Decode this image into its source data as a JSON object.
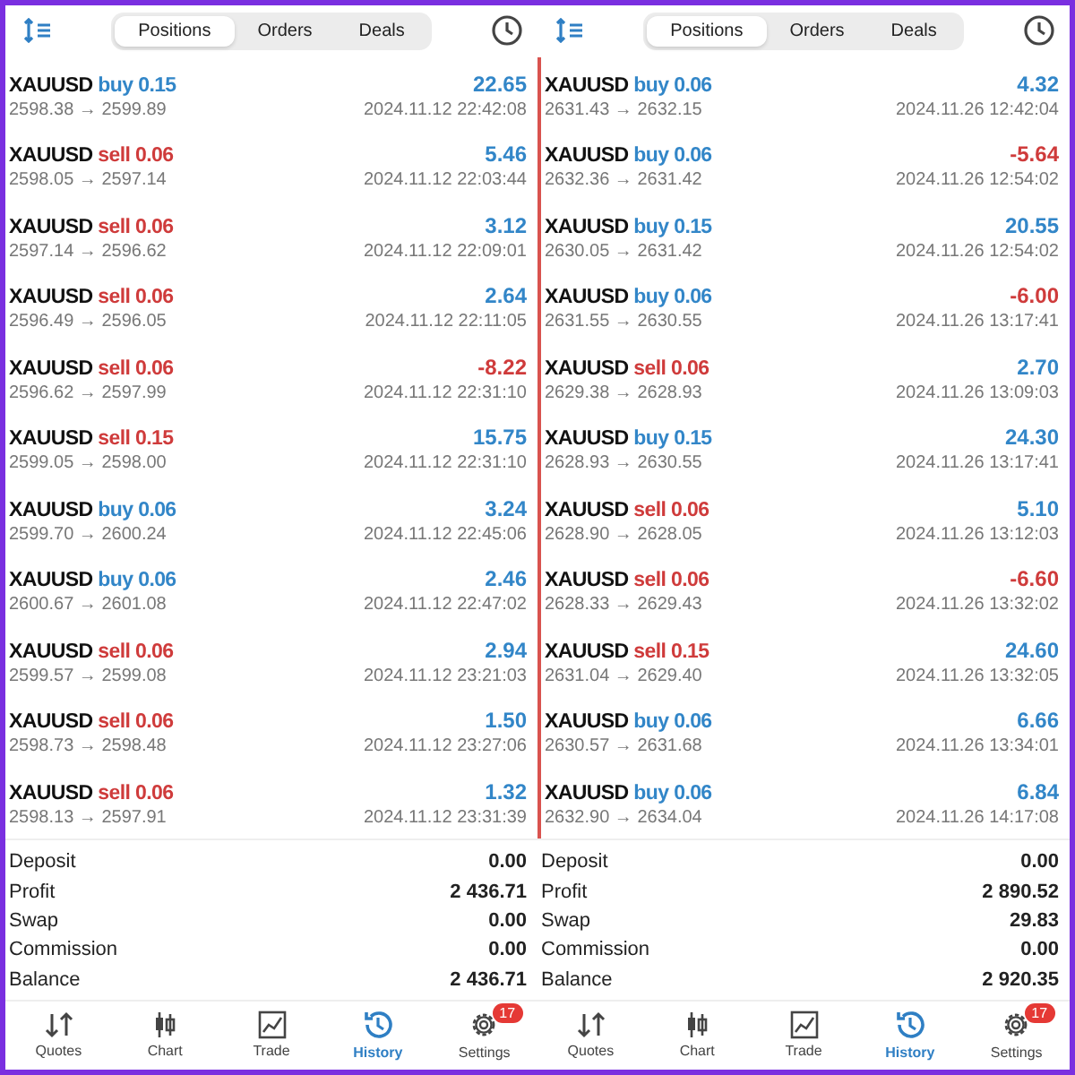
{
  "panels": [
    {
      "tabs": [
        {
          "label": "Positions",
          "selected": true
        },
        {
          "label": "Orders",
          "selected": false
        },
        {
          "label": "Deals",
          "selected": false
        }
      ],
      "trades": [
        {
          "symbol": "XAUUSD",
          "side": "buy",
          "volume": "0.15",
          "prices": "2598.38 → 2599.89",
          "profit": "22.65",
          "loss": false,
          "time": "2024.11.12 22:42:08"
        },
        {
          "symbol": "XAUUSD",
          "side": "sell",
          "volume": "0.06",
          "prices": "2598.05 → 2597.14",
          "profit": "5.46",
          "loss": false,
          "time": "2024.11.12 22:03:44"
        },
        {
          "symbol": "XAUUSD",
          "side": "sell",
          "volume": "0.06",
          "prices": "2597.14 → 2596.62",
          "profit": "3.12",
          "loss": false,
          "time": "2024.11.12 22:09:01"
        },
        {
          "symbol": "XAUUSD",
          "side": "sell",
          "volume": "0.06",
          "prices": "2596.49 → 2596.05",
          "profit": "2.64",
          "loss": false,
          "time": "2024.11.12 22:11:05"
        },
        {
          "symbol": "XAUUSD",
          "side": "sell",
          "volume": "0.06",
          "prices": "2596.62 → 2597.99",
          "profit": "-8.22",
          "loss": true,
          "time": "2024.11.12 22:31:10"
        },
        {
          "symbol": "XAUUSD",
          "side": "sell",
          "volume": "0.15",
          "prices": "2599.05 → 2598.00",
          "profit": "15.75",
          "loss": false,
          "time": "2024.11.12 22:31:10"
        },
        {
          "symbol": "XAUUSD",
          "side": "buy",
          "volume": "0.06",
          "prices": "2599.70 → 2600.24",
          "profit": "3.24",
          "loss": false,
          "time": "2024.11.12 22:45:06"
        },
        {
          "symbol": "XAUUSD",
          "side": "buy",
          "volume": "0.06",
          "prices": "2600.67 → 2601.08",
          "profit": "2.46",
          "loss": false,
          "time": "2024.11.12 22:47:02"
        },
        {
          "symbol": "XAUUSD",
          "side": "sell",
          "volume": "0.06",
          "prices": "2599.57 → 2599.08",
          "profit": "2.94",
          "loss": false,
          "time": "2024.11.12 23:21:03"
        },
        {
          "symbol": "XAUUSD",
          "side": "sell",
          "volume": "0.06",
          "prices": "2598.73 → 2598.48",
          "profit": "1.50",
          "loss": false,
          "time": "2024.11.12 23:27:06"
        },
        {
          "symbol": "XAUUSD",
          "side": "sell",
          "volume": "0.06",
          "prices": "2598.13 → 2597.91",
          "profit": "1.32",
          "loss": false,
          "time": "2024.11.12 23:31:39"
        }
      ],
      "summary": [
        {
          "label": "Deposit",
          "value": "0.00"
        },
        {
          "label": "Profit",
          "value": "2 436.71"
        },
        {
          "label": "Swap",
          "value": "0.00"
        },
        {
          "label": "Commission",
          "value": "0.00"
        },
        {
          "label": "Balance",
          "value": "2 436.71"
        }
      ],
      "nav": [
        {
          "kind": "quotes",
          "label": "Quotes",
          "selected": false
        },
        {
          "kind": "chart",
          "label": "Chart",
          "selected": false
        },
        {
          "kind": "trade",
          "label": "Trade",
          "selected": false
        },
        {
          "kind": "history",
          "label": "History",
          "selected": true
        },
        {
          "kind": "settings",
          "label": "Settings",
          "selected": false,
          "badge": "17"
        }
      ]
    },
    {
      "tabs": [
        {
          "label": "Positions",
          "selected": true
        },
        {
          "label": "Orders",
          "selected": false
        },
        {
          "label": "Deals",
          "selected": false
        }
      ],
      "trades": [
        {
          "symbol": "XAUUSD",
          "side": "buy",
          "volume": "0.06",
          "prices": "2631.43 → 2632.15",
          "profit": "4.32",
          "loss": false,
          "time": "2024.11.26 12:42:04"
        },
        {
          "symbol": "XAUUSD",
          "side": "buy",
          "volume": "0.06",
          "prices": "2632.36 → 2631.42",
          "profit": "-5.64",
          "loss": true,
          "time": "2024.11.26 12:54:02"
        },
        {
          "symbol": "XAUUSD",
          "side": "buy",
          "volume": "0.15",
          "prices": "2630.05 → 2631.42",
          "profit": "20.55",
          "loss": false,
          "time": "2024.11.26 12:54:02"
        },
        {
          "symbol": "XAUUSD",
          "side": "buy",
          "volume": "0.06",
          "prices": "2631.55 → 2630.55",
          "profit": "-6.00",
          "loss": true,
          "time": "2024.11.26 13:17:41"
        },
        {
          "symbol": "XAUUSD",
          "side": "sell",
          "volume": "0.06",
          "prices": "2629.38 → 2628.93",
          "profit": "2.70",
          "loss": false,
          "time": "2024.11.26 13:09:03"
        },
        {
          "symbol": "XAUUSD",
          "side": "buy",
          "volume": "0.15",
          "prices": "2628.93 → 2630.55",
          "profit": "24.30",
          "loss": false,
          "time": "2024.11.26 13:17:41"
        },
        {
          "symbol": "XAUUSD",
          "side": "sell",
          "volume": "0.06",
          "prices": "2628.90 → 2628.05",
          "profit": "5.10",
          "loss": false,
          "time": "2024.11.26 13:12:03"
        },
        {
          "symbol": "XAUUSD",
          "side": "sell",
          "volume": "0.06",
          "prices": "2628.33 → 2629.43",
          "profit": "-6.60",
          "loss": true,
          "time": "2024.11.26 13:32:02"
        },
        {
          "symbol": "XAUUSD",
          "side": "sell",
          "volume": "0.15",
          "prices": "2631.04 → 2629.40",
          "profit": "24.60",
          "loss": false,
          "time": "2024.11.26 13:32:05"
        },
        {
          "symbol": "XAUUSD",
          "side": "buy",
          "volume": "0.06",
          "prices": "2630.57 → 2631.68",
          "profit": "6.66",
          "loss": false,
          "time": "2024.11.26 13:34:01"
        },
        {
          "symbol": "XAUUSD",
          "side": "buy",
          "volume": "0.06",
          "prices": "2632.90 → 2634.04",
          "profit": "6.84",
          "loss": false,
          "time": "2024.11.26 14:17:08"
        }
      ],
      "summary": [
        {
          "label": "Deposit",
          "value": "0.00"
        },
        {
          "label": "Profit",
          "value": "2 890.52"
        },
        {
          "label": "Swap",
          "value": "29.83"
        },
        {
          "label": "Commission",
          "value": "0.00"
        },
        {
          "label": "Balance",
          "value": "2 920.35"
        }
      ],
      "nav": [
        {
          "kind": "quotes",
          "label": "Quotes",
          "selected": false
        },
        {
          "kind": "chart",
          "label": "Chart",
          "selected": false
        },
        {
          "kind": "trade",
          "label": "Trade",
          "selected": false
        },
        {
          "kind": "history",
          "label": "History",
          "selected": true
        },
        {
          "kind": "settings",
          "label": "Settings",
          "selected": false,
          "badge": "17"
        }
      ]
    }
  ]
}
